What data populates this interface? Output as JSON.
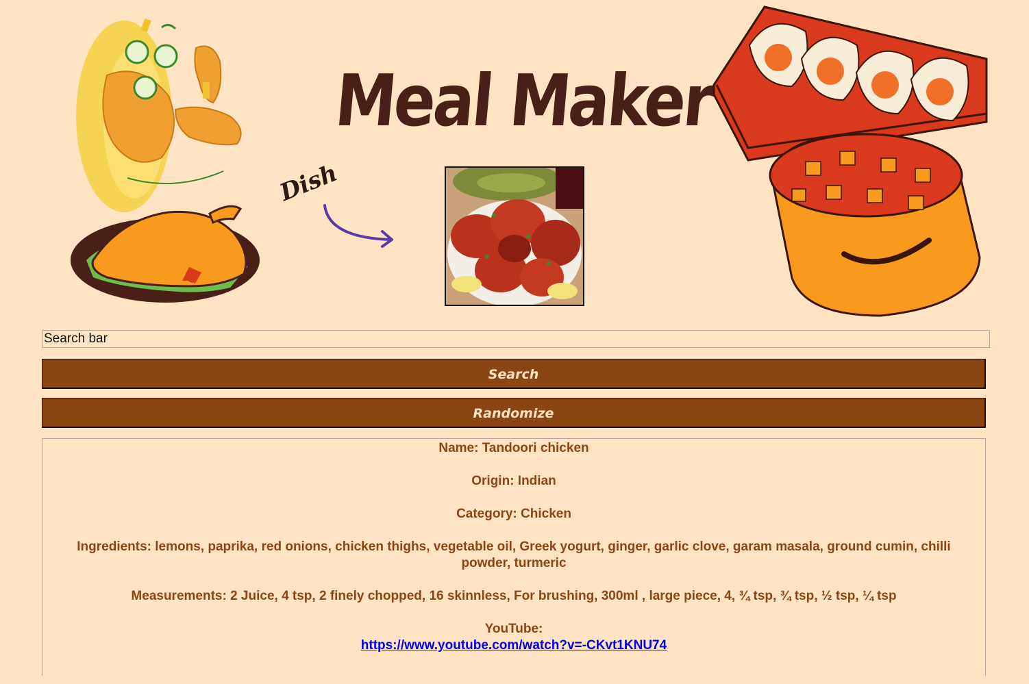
{
  "header": {
    "title": "Meal Maker",
    "dish_label": "Dish"
  },
  "search": {
    "placeholder": "Search bar",
    "search_label": "Search",
    "randomize_label": "Randomize"
  },
  "meal": {
    "name_text": "Name: Tandoori chicken",
    "origin_text": "Origin: Indian",
    "category_text": "Category: Chicken",
    "ingredients_text": "Ingredients: lemons, paprika, red onions, chicken thighs, vegetable oil, Greek yogurt, ginger, garlic clove, garam masala, ground cumin, chilli powder, turmeric",
    "measurements_text": "Measurements: 2 Juice, 4 tsp, 2 finely chopped, 16 skinnless, For brushing, 300ml , large piece, 4, ¾ tsp, ¾ tsp, ½ tsp, ¼ tsp",
    "youtube_label": "YouTube:",
    "youtube_url": "https://www.youtube.com/watch?v=-CKvt1KNU74"
  },
  "colors": {
    "background": "#ffe4c4",
    "button": "#8b4513",
    "button_text": "#ffe4c4",
    "result_text": "#8b4513",
    "title": "#4a1f17",
    "link": "#0000ee"
  },
  "icons": {
    "left_illustration": "roast-chicken-illustration",
    "right_illustration": "curry-pot-illustration",
    "arrow": "curved-arrow-icon"
  }
}
